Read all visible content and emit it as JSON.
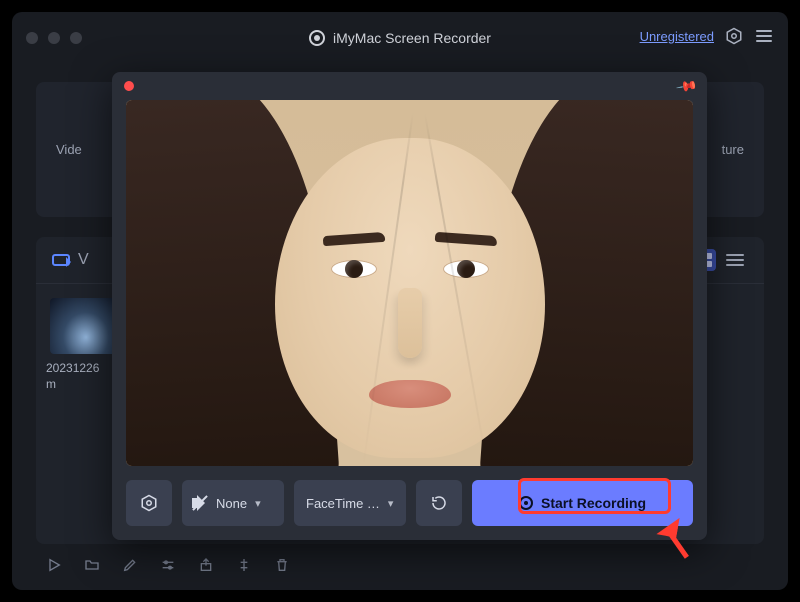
{
  "app": {
    "title": "iMyMac Screen Recorder",
    "account_status": "Unregistered"
  },
  "background": {
    "tab_left_hint": "Vide",
    "tab_right_hint": "ture",
    "section_label_hint": "V",
    "thumbnail_label_line1": "20231226",
    "thumbnail_label_line2": "m"
  },
  "modal": {
    "audio_label": "None",
    "camera_label": "FaceTime …",
    "start_button": "Start Recording"
  }
}
